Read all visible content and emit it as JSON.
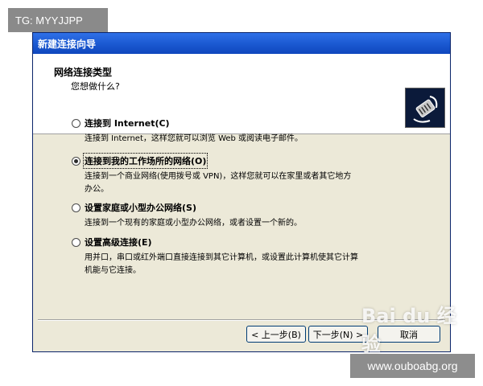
{
  "overlays": {
    "tag_text": "TG: MYYJJPP",
    "url_text": "www.ouboabg.org"
  },
  "window": {
    "title": "新建连接向导",
    "header_title": "网络连接类型",
    "header_subtitle": "您想做什么?"
  },
  "options": [
    {
      "label": "连接到 Internet(C)",
      "description": "连接到 Internet，这样您就可以浏览 Web 或阅读电子邮件。",
      "selected": false
    },
    {
      "label": "连接到我的工作场所的网络(O)",
      "description": "连接到一个商业网络(使用拨号或 VPN)，这样您就可以在家里或者其它地方办公。",
      "selected": true
    },
    {
      "label": "设置家庭或小型办公网络(S)",
      "description": "连接到一个现有的家庭或小型办公网络，或者设置一个新的。",
      "selected": false
    },
    {
      "label": "设置高级连接(E)",
      "description": "用并口，串口或红外端口直接连接到其它计算机，或设置此计算机使其它计算机能与它连接。",
      "selected": false
    }
  ],
  "buttons": {
    "back": "< 上一步(B)",
    "next": "下一步(N) >",
    "cancel": "取消"
  },
  "watermark": {
    "text": "Bai du 经验"
  },
  "colors": {
    "titlebar": "#1a58d0",
    "dialog_bg": "#ece9d8",
    "header_bg": "#ffffff"
  }
}
